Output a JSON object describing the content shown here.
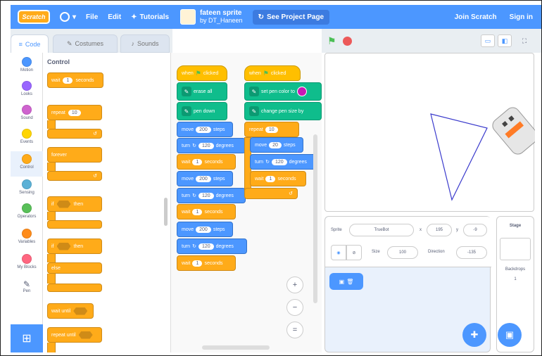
{
  "menubar": {
    "logo": "Scratch",
    "file": "File",
    "edit": "Edit",
    "tutorials": "Tutorials",
    "project_title": "fateen sprite",
    "project_author": "by DT_Haneen",
    "see_project": "See Project Page",
    "join": "Join Scratch",
    "signin": "Sign in"
  },
  "tabs": {
    "code": "Code",
    "costumes": "Costumes",
    "sounds": "Sounds"
  },
  "categories": [
    {
      "label": "Motion",
      "color": "#4c97ff"
    },
    {
      "label": "Looks",
      "color": "#9966ff"
    },
    {
      "label": "Sound",
      "color": "#cf63cf"
    },
    {
      "label": "Events",
      "color": "#ffd500"
    },
    {
      "label": "Control",
      "color": "#ffab19"
    },
    {
      "label": "Sensing",
      "color": "#5cb1d6"
    },
    {
      "label": "Operators",
      "color": "#59c059"
    },
    {
      "label": "Variables",
      "color": "#ff8c1a"
    },
    {
      "label": "My Blocks",
      "color": "#ff6680"
    },
    {
      "label": "Pen",
      "color": "#0fbd8c"
    }
  ],
  "palette": {
    "title": "Control",
    "wait": "wait",
    "wait_val": "1",
    "seconds": "seconds",
    "repeat": "repeat",
    "repeat_val": "10",
    "forever": "forever",
    "if": "if",
    "then": "then",
    "else": "else",
    "wait_until": "wait until",
    "repeat_until": "repeat until"
  },
  "script1": {
    "hat": "when",
    "clicked": "clicked",
    "erase": "erase all",
    "pendown": "pen down",
    "move": "move",
    "steps": "steps",
    "move_val": "200",
    "turn": "turn",
    "degrees": "degrees",
    "turn_val": "120",
    "wait": "wait",
    "wait_val": "1",
    "seconds": "seconds"
  },
  "script2": {
    "hat": "when",
    "clicked": "clicked",
    "setpen": "set pen color to",
    "changepen": "change pen size by",
    "repeat": "repeat",
    "repeat_val": "10",
    "move": "move",
    "move_val": "20",
    "steps": "steps",
    "turn": "turn",
    "turn_val": "120",
    "degrees": "degrees",
    "wait": "wait",
    "wait_val": "1",
    "seconds": "seconds"
  },
  "sprite_info": {
    "sprite_label": "Sprite",
    "sprite_name": "TrueBot",
    "x_label": "x",
    "x_val": "195",
    "y_label": "y",
    "y_val": "-9",
    "size_label": "Size",
    "size_val": "100",
    "dir_label": "Direction",
    "dir_val": "-135"
  },
  "stage_pane": {
    "title": "Stage",
    "backdrops_label": "Backdrops",
    "backdrops_count": "1"
  },
  "zoom": {
    "in": "+",
    "out": "−",
    "reset": "="
  },
  "colors": {
    "menubar": "#4c97ff",
    "control": "#ffab19",
    "pen": "#0fbd8c",
    "motion": "#4c97ff",
    "events": "#ffbf00"
  }
}
